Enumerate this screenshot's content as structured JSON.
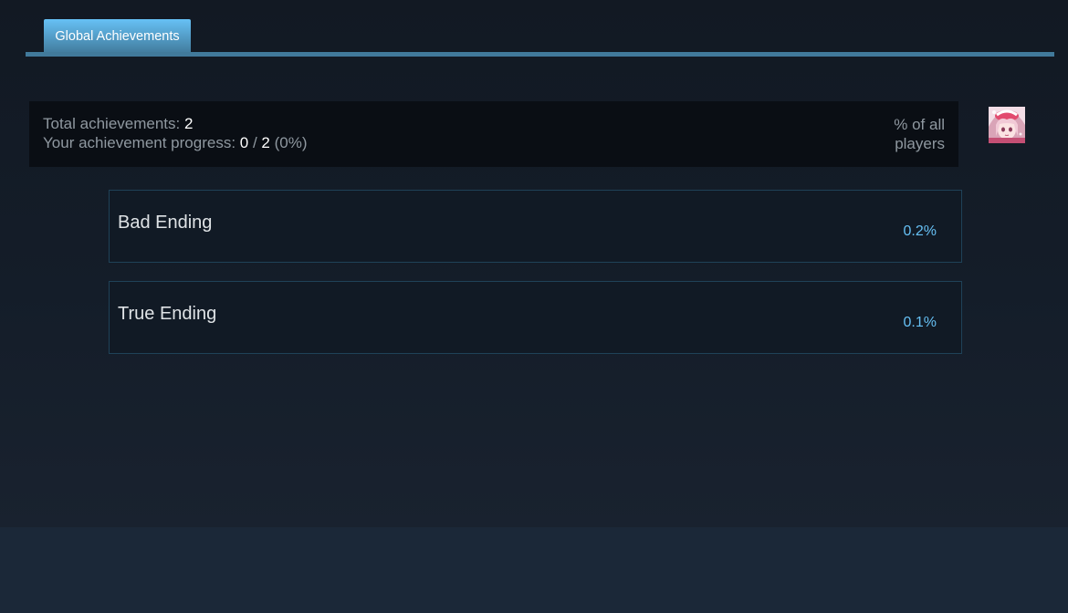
{
  "tabs": [
    {
      "label": "Global Achievements",
      "active": true
    }
  ],
  "summary": {
    "total_label": "Total achievements: ",
    "total_value": "2",
    "progress_label": "Your achievement progress: ",
    "progress_current": "0",
    "progress_separator": " / ",
    "progress_total": "2",
    "progress_percent": " (0%)",
    "percent_header_line1": "% of all",
    "percent_header_line2": "players"
  },
  "achievements": [
    {
      "name": "Bad Ending",
      "percent": "0.2%"
    },
    {
      "name": "True Ending",
      "percent": "0.1%"
    }
  ],
  "colors": {
    "accent": "#67c1f5",
    "tab_strip": "#417a9b",
    "percent_text": "#66c0f4",
    "muted_text": "#8f98a0",
    "footer_bg": "#1b2838"
  },
  "avatar": {
    "icon": "user-avatar-anime-girl"
  }
}
